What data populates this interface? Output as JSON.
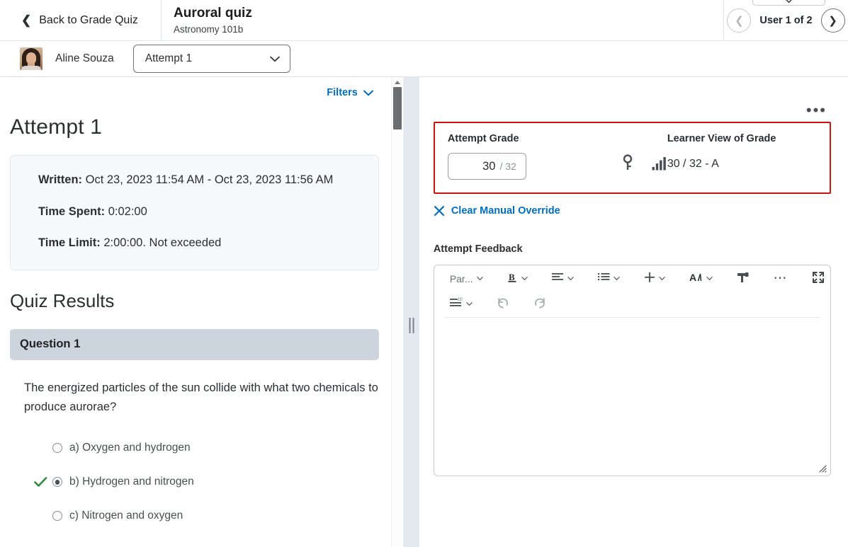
{
  "topbar": {
    "back_label": "Back to Grade Quiz",
    "back_icon": "chevron-left-icon",
    "quiz_title": "Auroral quiz",
    "course_name": "Astronomy 101b",
    "user_count": "User 1 of 2",
    "prev_icon": "circle-chevron-left-icon",
    "next_icon": "circle-chevron-right-icon"
  },
  "subbar": {
    "student_name": "Aline Souza",
    "attempt_select_value": "Attempt 1",
    "attempt_select_icon": "chevron-down-icon",
    "avatar_name": "avatar"
  },
  "left": {
    "filters_label": "Filters",
    "filters_icon": "chevron-down-icon",
    "attempt_heading": "Attempt 1",
    "info": {
      "written_label": "Written:",
      "written_value": "Oct 23, 2023 11:54 AM - Oct 23, 2023 11:56 AM",
      "time_spent_label": "Time Spent:",
      "time_spent_value": "0:02:00",
      "time_limit_label": "Time Limit:",
      "time_limit_value": "2:00:00. Not exceeded"
    },
    "results_heading": "Quiz Results",
    "question": {
      "band_label": "Question 1",
      "text": "The energized particles of the sun collide with what two chemicals to produce aurorae?",
      "answers": [
        {
          "label": "a) Oxygen and hydrogen",
          "selected": false,
          "correct": false
        },
        {
          "label": "b) Hydrogen and nitrogen",
          "selected": true,
          "correct": true
        },
        {
          "label": "c) Nitrogen and oxygen",
          "selected": false,
          "correct": false
        }
      ]
    }
  },
  "right": {
    "kebab_label": "•••",
    "attempt_grade_label": "Attempt Grade",
    "learner_view_label": "Learner View of Grade",
    "grade_value": "30",
    "grade_denominator": "/ 32",
    "learner_grade": "30 / 32 - A",
    "key_icon": "key-icon",
    "stats_icon": "bar-chart-icon",
    "clear_override_label": "Clear Manual Override",
    "clear_override_icon": "close-x-icon",
    "feedback_label": "Attempt Feedback",
    "toolbar_row1": [
      {
        "label": "Par...",
        "icon": "paragraph-format-icon",
        "chevron": true
      },
      {
        "label": "",
        "icon": "bold-icon",
        "chevron": true
      },
      {
        "label": "",
        "icon": "align-left-icon",
        "chevron": true
      },
      {
        "label": "",
        "icon": "bullet-list-icon",
        "chevron": true
      },
      {
        "label": "",
        "icon": "plus-insert-icon",
        "chevron": true
      },
      {
        "label": "",
        "icon": "font-style-icon",
        "chevron": true
      },
      {
        "label": "",
        "icon": "format-painter-icon",
        "chevron": false
      },
      {
        "label": "",
        "icon": "more-options-icon",
        "chevron": false
      },
      {
        "label": "",
        "icon": "fullscreen-icon",
        "chevron": false
      }
    ],
    "toolbar_row2": [
      {
        "label": "",
        "icon": "numbered-lines-icon",
        "chevron": true
      },
      {
        "label": "",
        "icon": "undo-icon",
        "chevron": false
      },
      {
        "label": "",
        "icon": "redo-icon",
        "chevron": false
      }
    ],
    "feedback_text": "",
    "resize_icon": "resize-grip-icon"
  },
  "colors": {
    "link": "#006fbf",
    "highlight_border": "#c9130f",
    "question_band": "#ccd4dd",
    "correct_check": "#2f8a3e"
  }
}
